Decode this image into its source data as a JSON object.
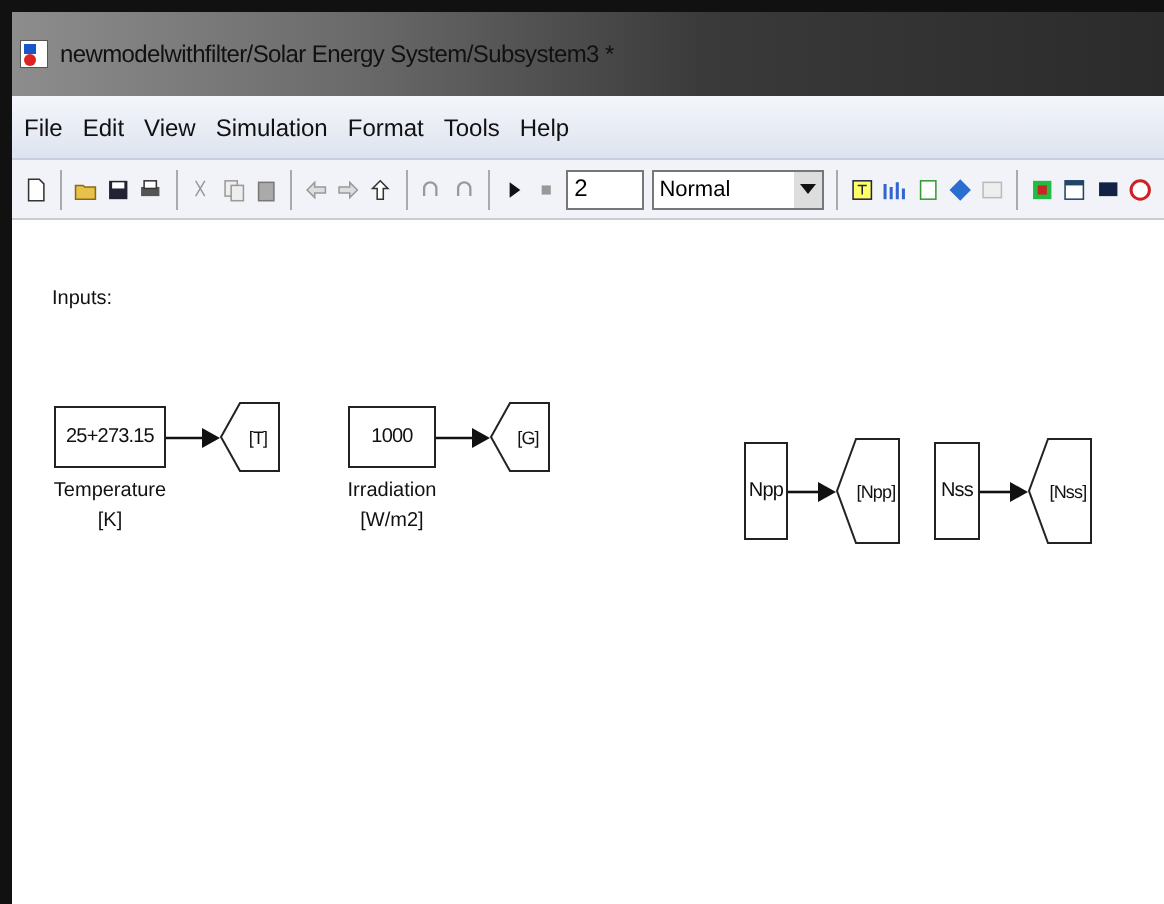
{
  "window": {
    "title": "newmodelwithfilter/Solar Energy System/Subsystem3 *"
  },
  "menu": [
    "File",
    "Edit",
    "View",
    "Simulation",
    "Format",
    "Tools",
    "Help"
  ],
  "toolbar": {
    "stop_time": "2",
    "mode": "Normal"
  },
  "canvas": {
    "heading": "Inputs:",
    "pairs": [
      {
        "source": "25+273.15",
        "tag": "[T]",
        "label": "Temperature",
        "unit": "[K]",
        "kind": "wide"
      },
      {
        "source": "1000",
        "tag": "[G]",
        "label": "Irradiation",
        "unit": "[W/m2]",
        "kind": "wide"
      },
      {
        "source": "Npp",
        "tag": "[Npp]",
        "kind": "tall"
      },
      {
        "source": "Nss",
        "tag": "[Nss]",
        "kind": "tall"
      }
    ]
  }
}
